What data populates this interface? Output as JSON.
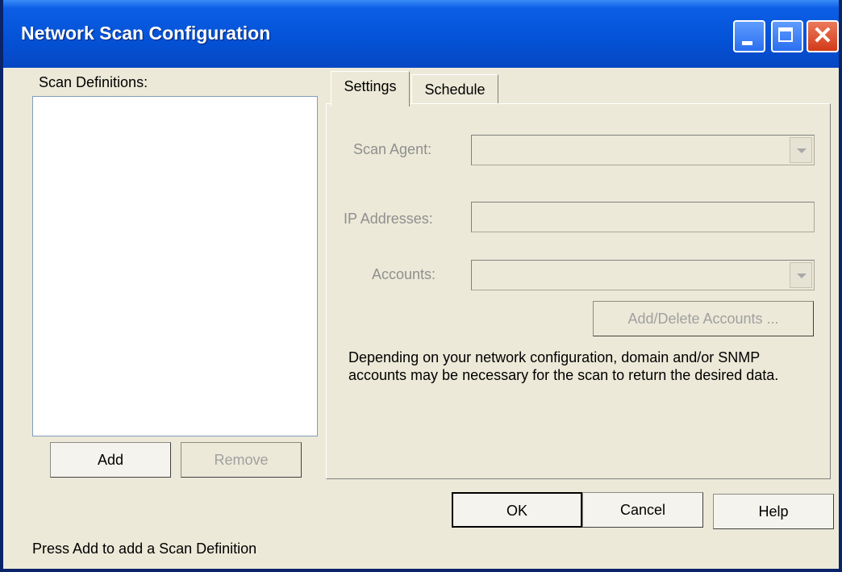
{
  "window": {
    "title": "Network Scan Configuration",
    "minimize_icon": "minimize-icon",
    "maximize_icon": "maximize-icon",
    "close_icon": "close-icon",
    "close_glyph": "✕"
  },
  "left": {
    "list_label": "Scan Definitions:",
    "add_label": "Add",
    "remove_label": "Remove"
  },
  "tabs": [
    {
      "label": "Settings",
      "active": true
    },
    {
      "label": "Schedule",
      "active": false
    }
  ],
  "settings": {
    "scan_agent_label": "Scan Agent:",
    "ip_addresses_label": "IP Addresses:",
    "accounts_label": "Accounts:",
    "add_delete_label": "Add/Delete Accounts ...",
    "description": "Depending on your network configuration, domain and/or SNMP accounts may be necessary for the scan to return the desired data."
  },
  "footer": {
    "ok_label": "OK",
    "cancel_label": "Cancel",
    "help_label": "Help",
    "status": "Press Add to add a Scan Definition"
  }
}
